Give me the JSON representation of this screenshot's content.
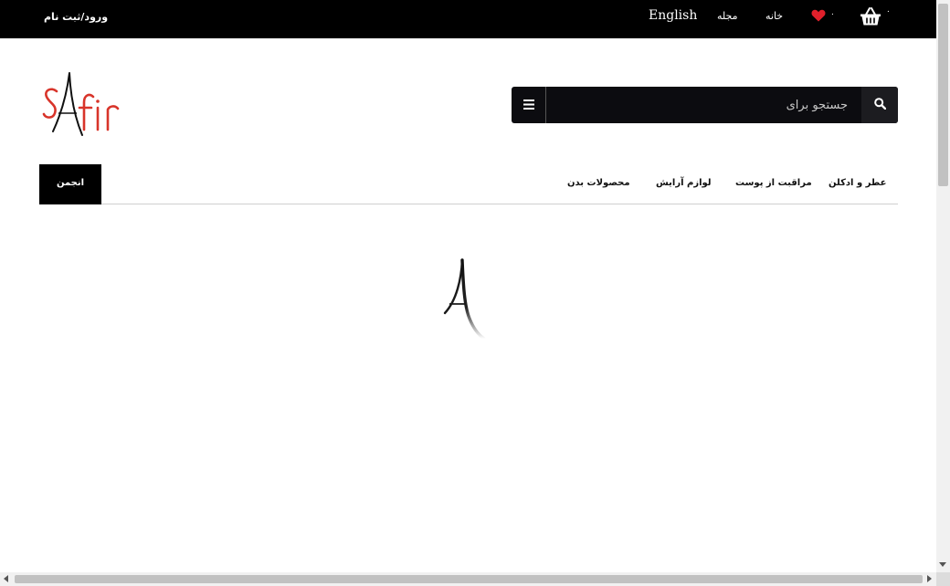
{
  "topbar": {
    "login_label": "ورود/ثبت نام",
    "language_label": "English",
    "magazine_label": "مجله",
    "home_label": "خانه",
    "wishlist_count": "۰",
    "cart_count": "۰",
    "heart_color": "#e0202b"
  },
  "logo": {
    "text": "SAfir",
    "primary_color": "#d8342a",
    "accent_color": "#111111"
  },
  "search": {
    "placeholder": "جستجو برای",
    "menu_icon": "bars-icon",
    "submit_icon": "search-icon"
  },
  "nav": {
    "forum_label": "انجمن",
    "items": [
      {
        "label": "محصولات بدن"
      },
      {
        "label": "لوازم آرایش"
      },
      {
        "label": "مراقبت از پوست"
      },
      {
        "label": "عطر و ادکلن"
      }
    ]
  },
  "loader": {
    "glyph": "A"
  }
}
